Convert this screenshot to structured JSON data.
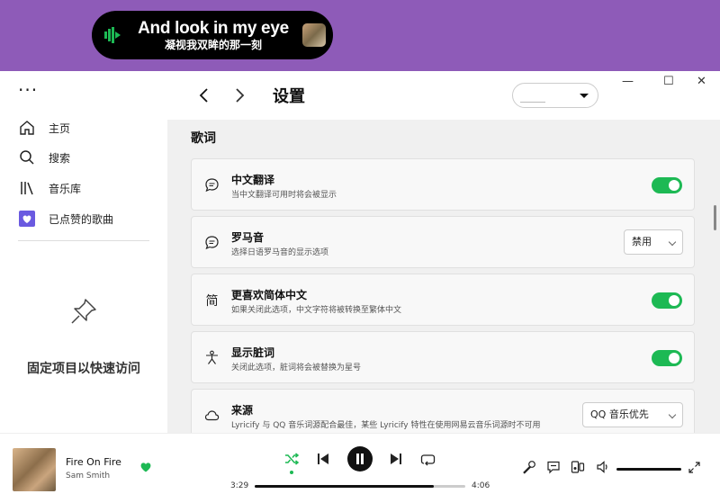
{
  "lyric_bar": {
    "main": "And look in my eye",
    "translation": "凝视我双眸的那一刻"
  },
  "sidebar": {
    "items": [
      {
        "label": "主页",
        "icon": "home-icon"
      },
      {
        "label": "搜索",
        "icon": "search-icon"
      },
      {
        "label": "音乐库",
        "icon": "library-icon"
      },
      {
        "label": "已点赞的歌曲",
        "icon": "liked-songs-icon"
      }
    ],
    "pin_prompt": "固定项目以快速访问"
  },
  "header": {
    "title": "设置",
    "window_controls": [
      "—",
      "☐",
      "✕"
    ]
  },
  "settings": {
    "section_title": "歌词",
    "rows": [
      {
        "title": "中文翻译",
        "desc": "当中文翻译可用时将会被显示",
        "control": "toggle",
        "on": true
      },
      {
        "title": "罗马音",
        "desc": "选择日语罗马音的显示选项",
        "control": "select",
        "value": "禁用"
      },
      {
        "title": "更喜欢简体中文",
        "desc": "如果关闭此选项，中文字符将被转换至繁体中文",
        "control": "toggle",
        "on": true
      },
      {
        "title": "显示脏词",
        "desc": "关闭此选项，脏词将会被替换为星号",
        "control": "toggle",
        "on": true
      },
      {
        "title": "来源",
        "desc": "Lyricify 与 QQ 音乐词源配合最佳，某些 Lyricify 特性在使用网易云音乐词源时不可用",
        "control": "select",
        "value": "QQ 音乐优先"
      }
    ],
    "row_icon_glyphs": {
      "simplified": "简"
    }
  },
  "player": {
    "track_title": "Fire On Fire",
    "artist": "Sam Smith",
    "elapsed": "3:29",
    "duration": "4:06",
    "progress": 0.85,
    "volume": 1.0
  },
  "colors": {
    "accent": "#1db954",
    "desktop": "#8e5bb8",
    "content_bg": "#f0f0f0"
  }
}
